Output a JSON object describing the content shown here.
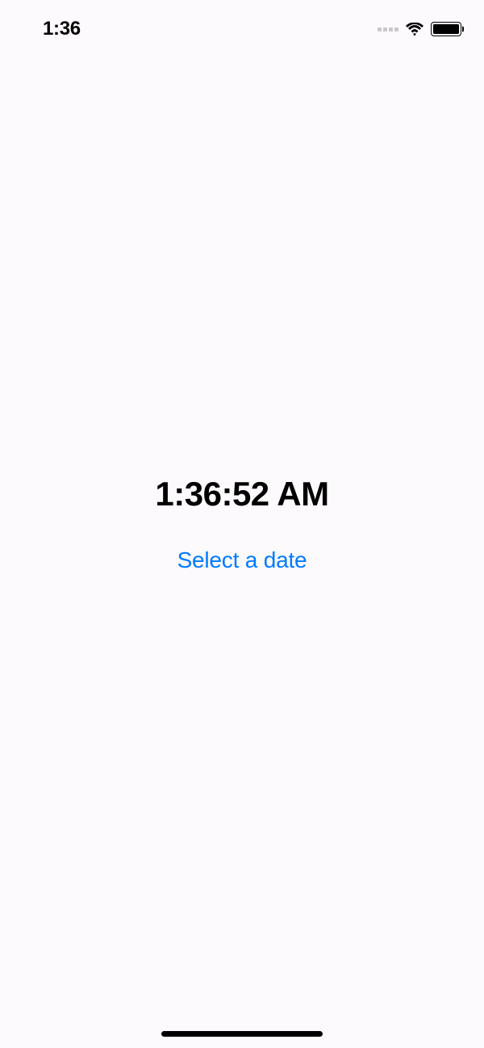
{
  "status_bar": {
    "time": "1:36"
  },
  "content": {
    "time_display": "1:36:52 AM",
    "select_button_label": "Select a date"
  }
}
